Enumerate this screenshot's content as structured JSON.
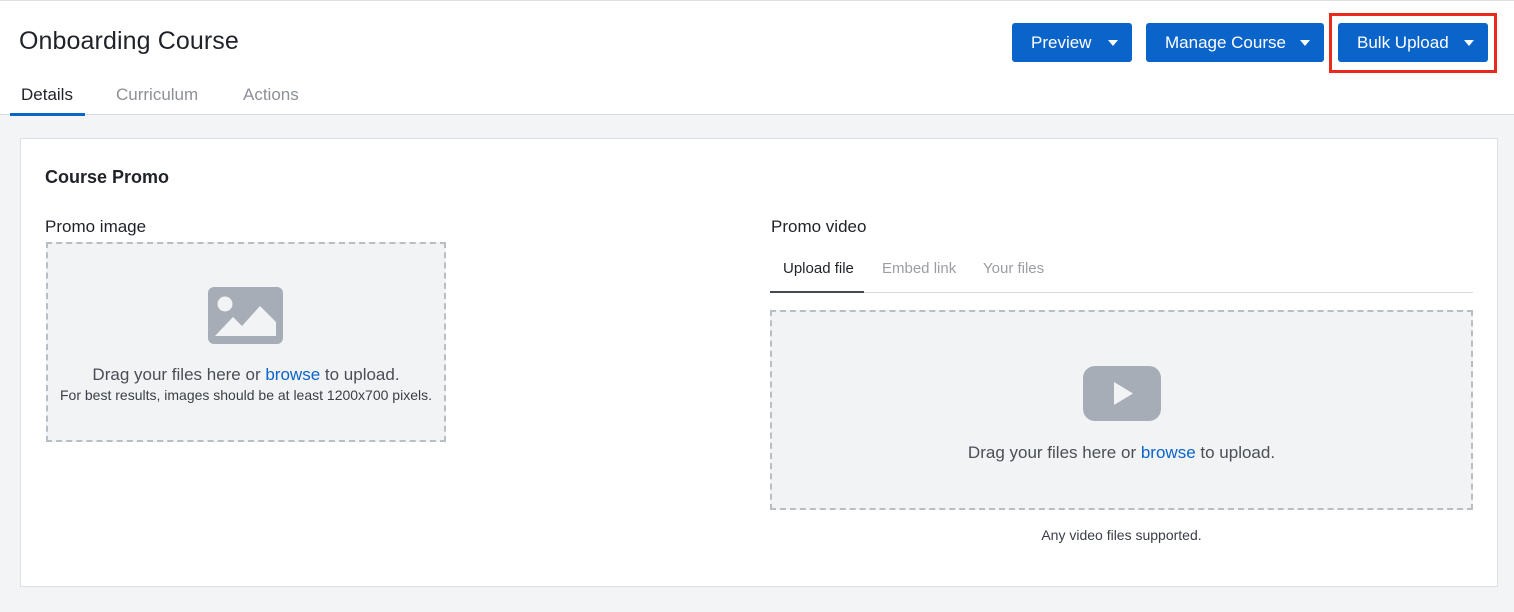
{
  "header": {
    "title": "Onboarding Course",
    "buttons": {
      "preview": "Preview",
      "manage": "Manage Course",
      "bulk": "Bulk Upload"
    },
    "tabs": [
      "Details",
      "Curriculum",
      "Actions"
    ],
    "accent_color": "#0a64c9",
    "highlight_color": "#e8291c"
  },
  "promo": {
    "section_title": "Course Promo",
    "image": {
      "label": "Promo image",
      "drag_text": "Drag your files here or",
      "browse": "browse",
      "after_text": "to upload.",
      "hint": "For best results, images should be at least 1200x700 pixels.",
      "icon": "image-placeholder-icon"
    },
    "video": {
      "label": "Promo video",
      "tabs": [
        "Upload file",
        "Embed link",
        "Your files"
      ],
      "drag_text": "Drag your files here or",
      "browse": "browse",
      "after_text": "to upload.",
      "note": "Any video files supported.",
      "icon": "play-icon"
    }
  }
}
